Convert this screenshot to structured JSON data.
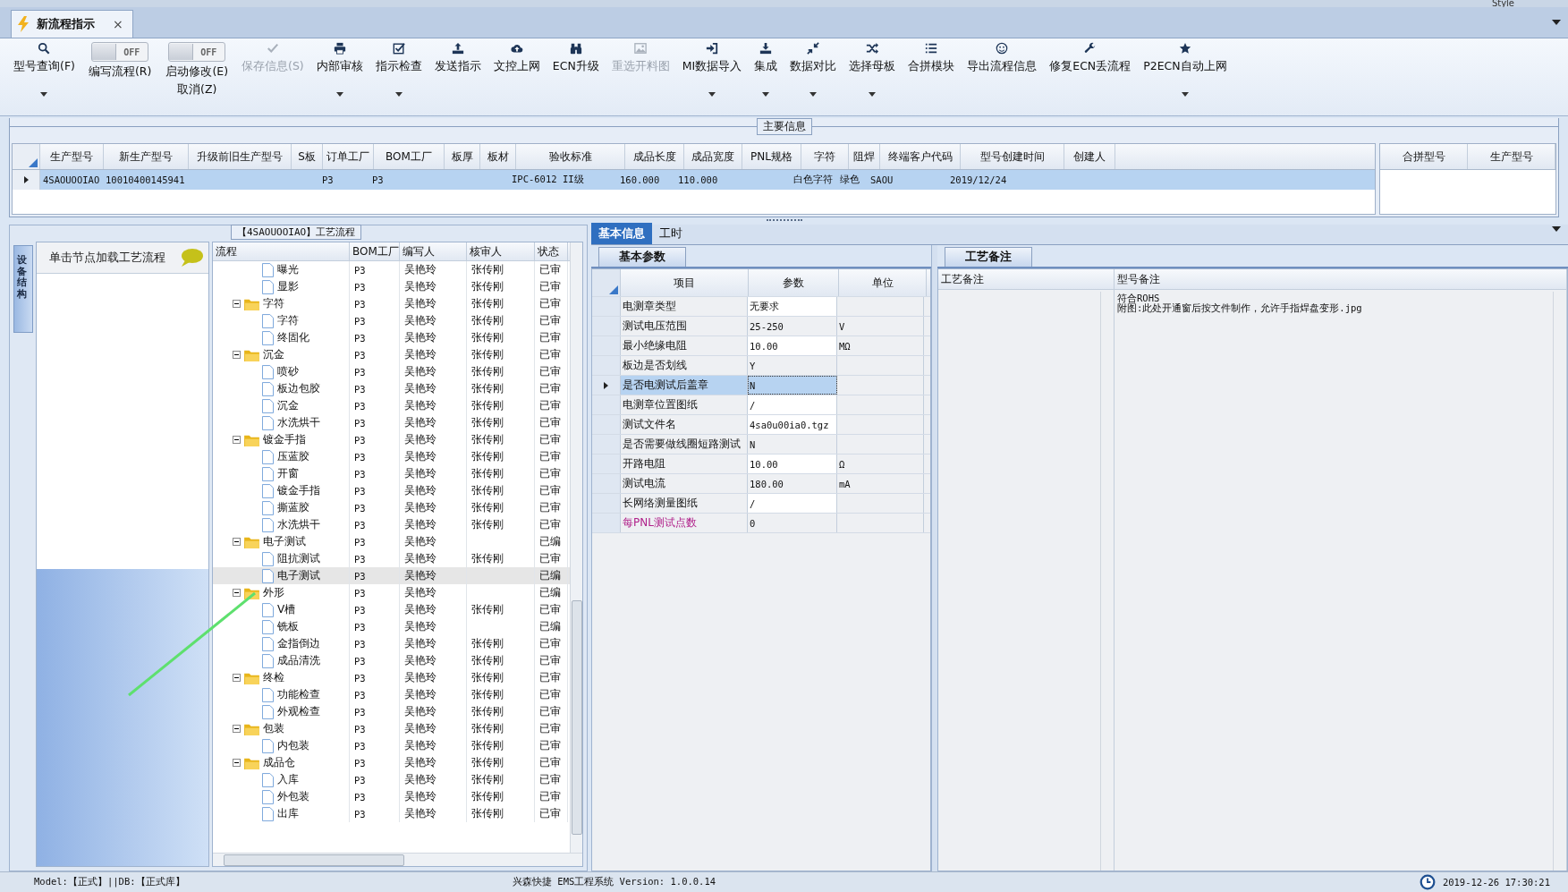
{
  "top_strip": {
    "style_label": "Style"
  },
  "tabs": [
    {
      "label": "新流程指示",
      "close": "×",
      "selected": true
    }
  ],
  "toolbar": [
    {
      "kind": "button",
      "label": "型号查询(F)",
      "disabled": false,
      "dropdown": true
    },
    {
      "kind": "toggle",
      "label": "编写流程(R)",
      "switch_text": "OFF",
      "on": false
    },
    {
      "kind": "toggle",
      "label": "启动修改(E)",
      "sublabel": "取消(Z)",
      "switch_text": "OFF",
      "on": false
    },
    {
      "kind": "button",
      "label": "保存信息(S)",
      "disabled": true,
      "dropdown": false
    },
    {
      "kind": "button",
      "label": "内部审核",
      "disabled": false,
      "dropdown": true
    },
    {
      "kind": "button",
      "label": "指示检查",
      "disabled": false,
      "dropdown": true
    },
    {
      "kind": "button",
      "label": "发送指示",
      "disabled": false,
      "dropdown": false
    },
    {
      "kind": "button",
      "label": "文控上网",
      "disabled": false,
      "dropdown": false
    },
    {
      "kind": "button",
      "label": "ECN升级",
      "disabled": false,
      "dropdown": false
    },
    {
      "kind": "button",
      "label": "重选开料图",
      "disabled": true,
      "dropdown": false
    },
    {
      "kind": "button",
      "label": "MI数据导入",
      "disabled": false,
      "dropdown": true
    },
    {
      "kind": "button",
      "label": "集成",
      "disabled": false,
      "dropdown": true
    },
    {
      "kind": "button",
      "label": "数据对比",
      "disabled": false,
      "dropdown": true
    },
    {
      "kind": "button",
      "label": "选择母板",
      "disabled": false,
      "dropdown": true
    },
    {
      "kind": "button",
      "label": "合拼模块",
      "disabled": false,
      "dropdown": false
    },
    {
      "kind": "button",
      "label": "导出流程信息",
      "disabled": false,
      "dropdown": false
    },
    {
      "kind": "button",
      "label": "修复ECN丢流程",
      "disabled": false,
      "dropdown": false
    },
    {
      "kind": "button",
      "label": "P2ECN自动上网",
      "disabled": false,
      "dropdown": true
    }
  ],
  "main_info": {
    "title": "主要信息",
    "columns": [
      "生产型号",
      "新生产型号",
      "升级前旧生产型号",
      "S板",
      "订单工厂",
      "BOM工厂",
      "板厚",
      "板材",
      "验收标准",
      "成品长度",
      "成品宽度",
      "PNL规格",
      "字符",
      "阻焊",
      "终端客户代码",
      "型号创建时间",
      "创建人"
    ],
    "rows": [
      {
        "selected": true,
        "cells": [
          "4SAOUOOIAO",
          "10010400145941",
          null,
          null,
          "P3",
          "P3",
          null,
          null,
          "IPC-6012 II级",
          "160.000",
          "110.000",
          null,
          "白色字符",
          "绿色",
          "SAOU",
          "2019/12/24",
          null
        ]
      }
    ],
    "side_columns": [
      "合拼型号",
      "生产型号"
    ]
  },
  "process": {
    "title": "【4SAOUOOIAO】工艺流程",
    "side_tab": "设备结构",
    "hint": "单击节点加载工艺流程",
    "columns": [
      "流程",
      "BOM工厂",
      "编写人",
      "核审人",
      "状态"
    ],
    "rows": [
      {
        "children": [
          {
            "name": "曝光",
            "bom": "P3",
            "writer": "吴艳玲",
            "reviewer": "张传刚",
            "status": "已审",
            "selected": false
          },
          {
            "name": "显影",
            "bom": "P3",
            "writer": "吴艳玲",
            "reviewer": "张传刚",
            "status": "已审",
            "selected": false
          }
        ]
      },
      {
        "name": "字符",
        "bom": "P3",
        "writer": "吴艳玲",
        "reviewer": "张传刚",
        "status": "已审",
        "selected": false,
        "expanded": true,
        "children": [
          {
            "name": "字符",
            "bom": "P3",
            "writer": "吴艳玲",
            "reviewer": "张传刚",
            "status": "已审",
            "selected": false
          },
          {
            "name": "终固化",
            "bom": "P3",
            "writer": "吴艳玲",
            "reviewer": "张传刚",
            "status": "已审",
            "selected": false
          }
        ]
      },
      {
        "name": "沉金",
        "bom": "P3",
        "writer": "吴艳玲",
        "reviewer": "张传刚",
        "status": "已审",
        "selected": false,
        "expanded": true,
        "children": [
          {
            "name": "喷砂",
            "bom": "P3",
            "writer": "吴艳玲",
            "reviewer": "张传刚",
            "status": "已审",
            "selected": false
          },
          {
            "name": "板边包胶",
            "bom": "P3",
            "writer": "吴艳玲",
            "reviewer": "张传刚",
            "status": "已审",
            "selected": false
          },
          {
            "name": "沉金",
            "bom": "P3",
            "writer": "吴艳玲",
            "reviewer": "张传刚",
            "status": "已审",
            "selected": false
          },
          {
            "name": "水洗烘干",
            "bom": "P3",
            "writer": "吴艳玲",
            "reviewer": "张传刚",
            "status": "已审",
            "selected": false
          }
        ]
      },
      {
        "name": "镀金手指",
        "bom": "P3",
        "writer": "吴艳玲",
        "reviewer": "张传刚",
        "status": "已审",
        "selected": false,
        "expanded": true,
        "children": [
          {
            "name": "压蓝胶",
            "bom": "P3",
            "writer": "吴艳玲",
            "reviewer": "张传刚",
            "status": "已审",
            "selected": false
          },
          {
            "name": "开窗",
            "bom": "P3",
            "writer": "吴艳玲",
            "reviewer": "张传刚",
            "status": "已审",
            "selected": false
          },
          {
            "name": "镀金手指",
            "bom": "P3",
            "writer": "吴艳玲",
            "reviewer": "张传刚",
            "status": "已审",
            "selected": false
          },
          {
            "name": "撕蓝胶",
            "bom": "P3",
            "writer": "吴艳玲",
            "reviewer": "张传刚",
            "status": "已审",
            "selected": false
          },
          {
            "name": "水洗烘干",
            "bom": "P3",
            "writer": "吴艳玲",
            "reviewer": "张传刚",
            "status": "已审",
            "selected": false
          }
        ]
      },
      {
        "name": "电子测试",
        "bom": "P3",
        "writer": "吴艳玲",
        "status": "已编",
        "selected": false,
        "expanded": true,
        "children": [
          {
            "name": "阻抗测试",
            "bom": "P3",
            "writer": "吴艳玲",
            "reviewer": "张传刚",
            "status": "已审",
            "selected": false
          },
          {
            "name": "电子测试",
            "bom": "P3",
            "writer": "吴艳玲",
            "status": "已编",
            "selected": true
          }
        ]
      },
      {
        "name": "外形",
        "bom": "P3",
        "writer": "吴艳玲",
        "status": "已编",
        "selected": false,
        "expanded": true,
        "children": [
          {
            "name": "V槽",
            "bom": "P3",
            "writer": "吴艳玲",
            "reviewer": "张传刚",
            "status": "已审",
            "selected": false
          },
          {
            "name": "铣板",
            "bom": "P3",
            "writer": "吴艳玲",
            "status": "已编",
            "selected": false
          },
          {
            "name": "金指倒边",
            "bom": "P3",
            "writer": "吴艳玲",
            "reviewer": "张传刚",
            "status": "已审",
            "selected": false
          },
          {
            "name": "成品清洗",
            "bom": "P3",
            "writer": "吴艳玲",
            "reviewer": "张传刚",
            "status": "已审",
            "selected": false
          }
        ]
      },
      {
        "name": "终检",
        "bom": "P3",
        "writer": "吴艳玲",
        "reviewer": "张传刚",
        "status": "已审",
        "selected": false,
        "expanded": true,
        "children": [
          {
            "name": "功能检查",
            "bom": "P3",
            "writer": "吴艳玲",
            "reviewer": "张传刚",
            "status": "已审",
            "selected": false
          },
          {
            "name": "外观检查",
            "bom": "P3",
            "writer": "吴艳玲",
            "reviewer": "张传刚",
            "status": "已审",
            "selected": false
          }
        ]
      },
      {
        "name": "包装",
        "bom": "P3",
        "writer": "吴艳玲",
        "reviewer": "张传刚",
        "status": "已审",
        "selected": false,
        "expanded": true,
        "children": [
          {
            "name": "内包装",
            "bom": "P3",
            "writer": "吴艳玲",
            "reviewer": "张传刚",
            "status": "已审",
            "selected": false
          }
        ]
      },
      {
        "name": "成品仓",
        "bom": "P3",
        "writer": "吴艳玲",
        "reviewer": "张传刚",
        "status": "已审",
        "selected": false,
        "expanded": true,
        "children": [
          {
            "name": "入库",
            "bom": "P3",
            "writer": "吴艳玲",
            "reviewer": "张传刚",
            "status": "已审",
            "selected": false
          },
          {
            "name": "外包装",
            "bom": "P3",
            "writer": "吴艳玲",
            "reviewer": "张传刚",
            "status": "已审",
            "selected": false
          },
          {
            "name": "出库",
            "bom": "P3",
            "writer": "吴艳玲",
            "reviewer": "张传刚",
            "status": "已审",
            "selected": false
          }
        ]
      }
    ]
  },
  "detail_tabs": [
    {
      "label": "基本信息",
      "selected": true
    },
    {
      "label": "工时",
      "selected": false
    }
  ],
  "params": {
    "title": "基本参数",
    "columns": [
      "项目",
      "参数",
      "单位"
    ],
    "rows": [
      {
        "item": "电测章类型",
        "value": "无要求",
        "editable": true,
        "flagged": false,
        "selected": false
      },
      {
        "item": "测试电压范围",
        "value": "25-250",
        "unit": "V",
        "editable": false,
        "flagged": false,
        "selected": false
      },
      {
        "item": "最小绝缘电阻",
        "value": "10.00",
        "unit": "MΩ",
        "editable": true,
        "flagged": false,
        "selected": false
      },
      {
        "item": "板边是否划线",
        "value": "Y",
        "editable": false,
        "flagged": false,
        "selected": false
      },
      {
        "item": "是否电测试后盖章",
        "value": "N",
        "editable": false,
        "flagged": false,
        "selected": true
      },
      {
        "item": "电测章位置图纸",
        "value": "/",
        "editable": true,
        "flagged": false,
        "selected": false
      },
      {
        "item": "测试文件名",
        "value": "4sa0u00ia0.tgz",
        "editable": true,
        "flagged": false,
        "selected": false
      },
      {
        "item": "是否需要做线圈短路测试",
        "value": "N",
        "editable": false,
        "flagged": false,
        "selected": false
      },
      {
        "item": "开路电阻",
        "value": "10.00",
        "unit": "Ω",
        "editable": true,
        "flagged": false,
        "selected": false
      },
      {
        "item": "测试电流",
        "value": "180.00",
        "unit": "mA",
        "editable": false,
        "flagged": false,
        "selected": false
      },
      {
        "item": "长网络测量图纸",
        "value": "/",
        "editable": true,
        "flagged": false,
        "selected": false
      },
      {
        "item": "每PNL测试点数",
        "value": "0",
        "editable": false,
        "flagged": true,
        "selected": false
      }
    ]
  },
  "remarks": {
    "title": "工艺备注",
    "columns": [
      "工艺备注",
      "型号备注"
    ],
    "model_remark_lines": [
      "符合ROHS",
      "附图:此处开通窗后按文件制作，允许手指焊盘变形.jpg"
    ]
  },
  "status_bar": {
    "left": "Model:【正式】||DB:【正式库】",
    "center": "兴森快捷  EMS工程系统  Version: 1.0.0.14",
    "time": "2019-12-26 17:30:21"
  }
}
